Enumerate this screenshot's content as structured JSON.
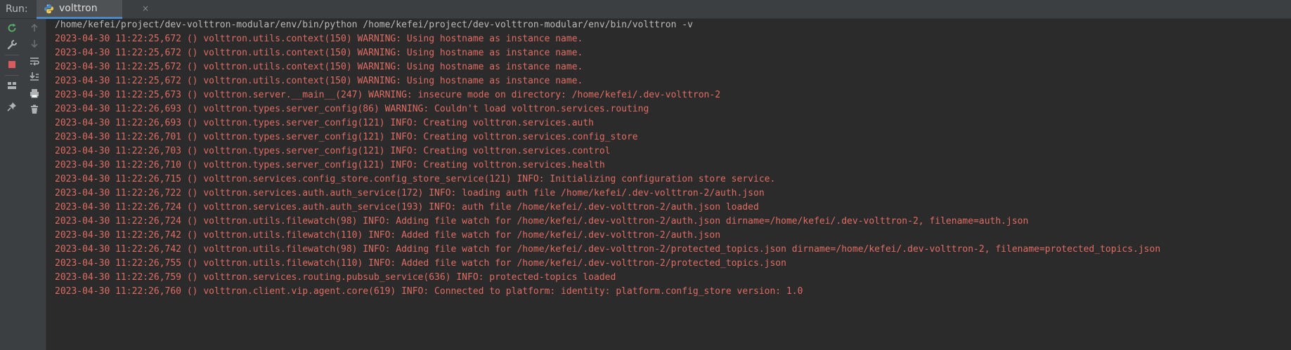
{
  "run_panel": {
    "label": "Run:",
    "tab": {
      "icon": "python-icon",
      "title": "volttron",
      "close_glyph": "×"
    }
  },
  "toolbar": {
    "left_column": [
      "rerun-icon",
      "wrench-icon",
      "stop-icon",
      "layout-icon",
      "pin-icon"
    ],
    "right_column": [
      "up-arrow-icon",
      "down-arrow-icon",
      "soft-wrap-icon",
      "scroll-to-end-icon",
      "print-icon",
      "trash-icon"
    ]
  },
  "console": {
    "command": "/home/kefei/project/dev-volttron-modular/env/bin/python /home/kefei/project/dev-volttron-modular/env/bin/volttron -v",
    "lines": [
      "2023-04-30 11:22:25,672 () volttron.utils.context(150) WARNING: Using hostname as instance name.",
      "2023-04-30 11:22:25,672 () volttron.utils.context(150) WARNING: Using hostname as instance name.",
      "2023-04-30 11:22:25,672 () volttron.utils.context(150) WARNING: Using hostname as instance name.",
      "2023-04-30 11:22:25,672 () volttron.utils.context(150) WARNING: Using hostname as instance name.",
      "2023-04-30 11:22:25,673 () volttron.server.__main__(247) WARNING: insecure mode on directory: /home/kefei/.dev-volttron-2",
      "2023-04-30 11:22:26,693 () volttron.types.server_config(86) WARNING: Couldn't load volttron.services.routing",
      "2023-04-30 11:22:26,693 () volttron.types.server_config(121) INFO: Creating volttron.services.auth",
      "2023-04-30 11:22:26,701 () volttron.types.server_config(121) INFO: Creating volttron.services.config_store",
      "2023-04-30 11:22:26,703 () volttron.types.server_config(121) INFO: Creating volttron.services.control",
      "2023-04-30 11:22:26,710 () volttron.types.server_config(121) INFO: Creating volttron.services.health",
      "2023-04-30 11:22:26,715 () volttron.services.config_store.config_store_service(121) INFO: Initializing configuration store service.",
      "2023-04-30 11:22:26,722 () volttron.services.auth.auth_service(172) INFO: loading auth file /home/kefei/.dev-volttron-2/auth.json",
      "2023-04-30 11:22:26,724 () volttron.services.auth.auth_service(193) INFO: auth file /home/kefei/.dev-volttron-2/auth.json loaded",
      "2023-04-30 11:22:26,724 () volttron.utils.filewatch(98) INFO: Adding file watch for /home/kefei/.dev-volttron-2/auth.json dirname=/home/kefei/.dev-volttron-2, filename=auth.json",
      "2023-04-30 11:22:26,742 () volttron.utils.filewatch(110) INFO: Added file watch for /home/kefei/.dev-volttron-2/auth.json",
      "2023-04-30 11:22:26,742 () volttron.utils.filewatch(98) INFO: Adding file watch for /home/kefei/.dev-volttron-2/protected_topics.json dirname=/home/kefei/.dev-volttron-2, filename=protected_topics.json",
      "2023-04-30 11:22:26,755 () volttron.utils.filewatch(110) INFO: Added file watch for /home/kefei/.dev-volttron-2/protected_topics.json",
      "2023-04-30 11:22:26,759 () volttron.services.routing.pubsub_service(636) INFO: protected-topics loaded",
      "2023-04-30 11:22:26,760 () volttron.client.vip.agent.core(619) INFO: Connected to platform: identity: platform.config_store version: 1.0"
    ]
  },
  "colors": {
    "log_text": "#e06c63",
    "command_text": "#bbbbbb",
    "background": "#2b2b2b",
    "accent": "#4a88c7"
  }
}
